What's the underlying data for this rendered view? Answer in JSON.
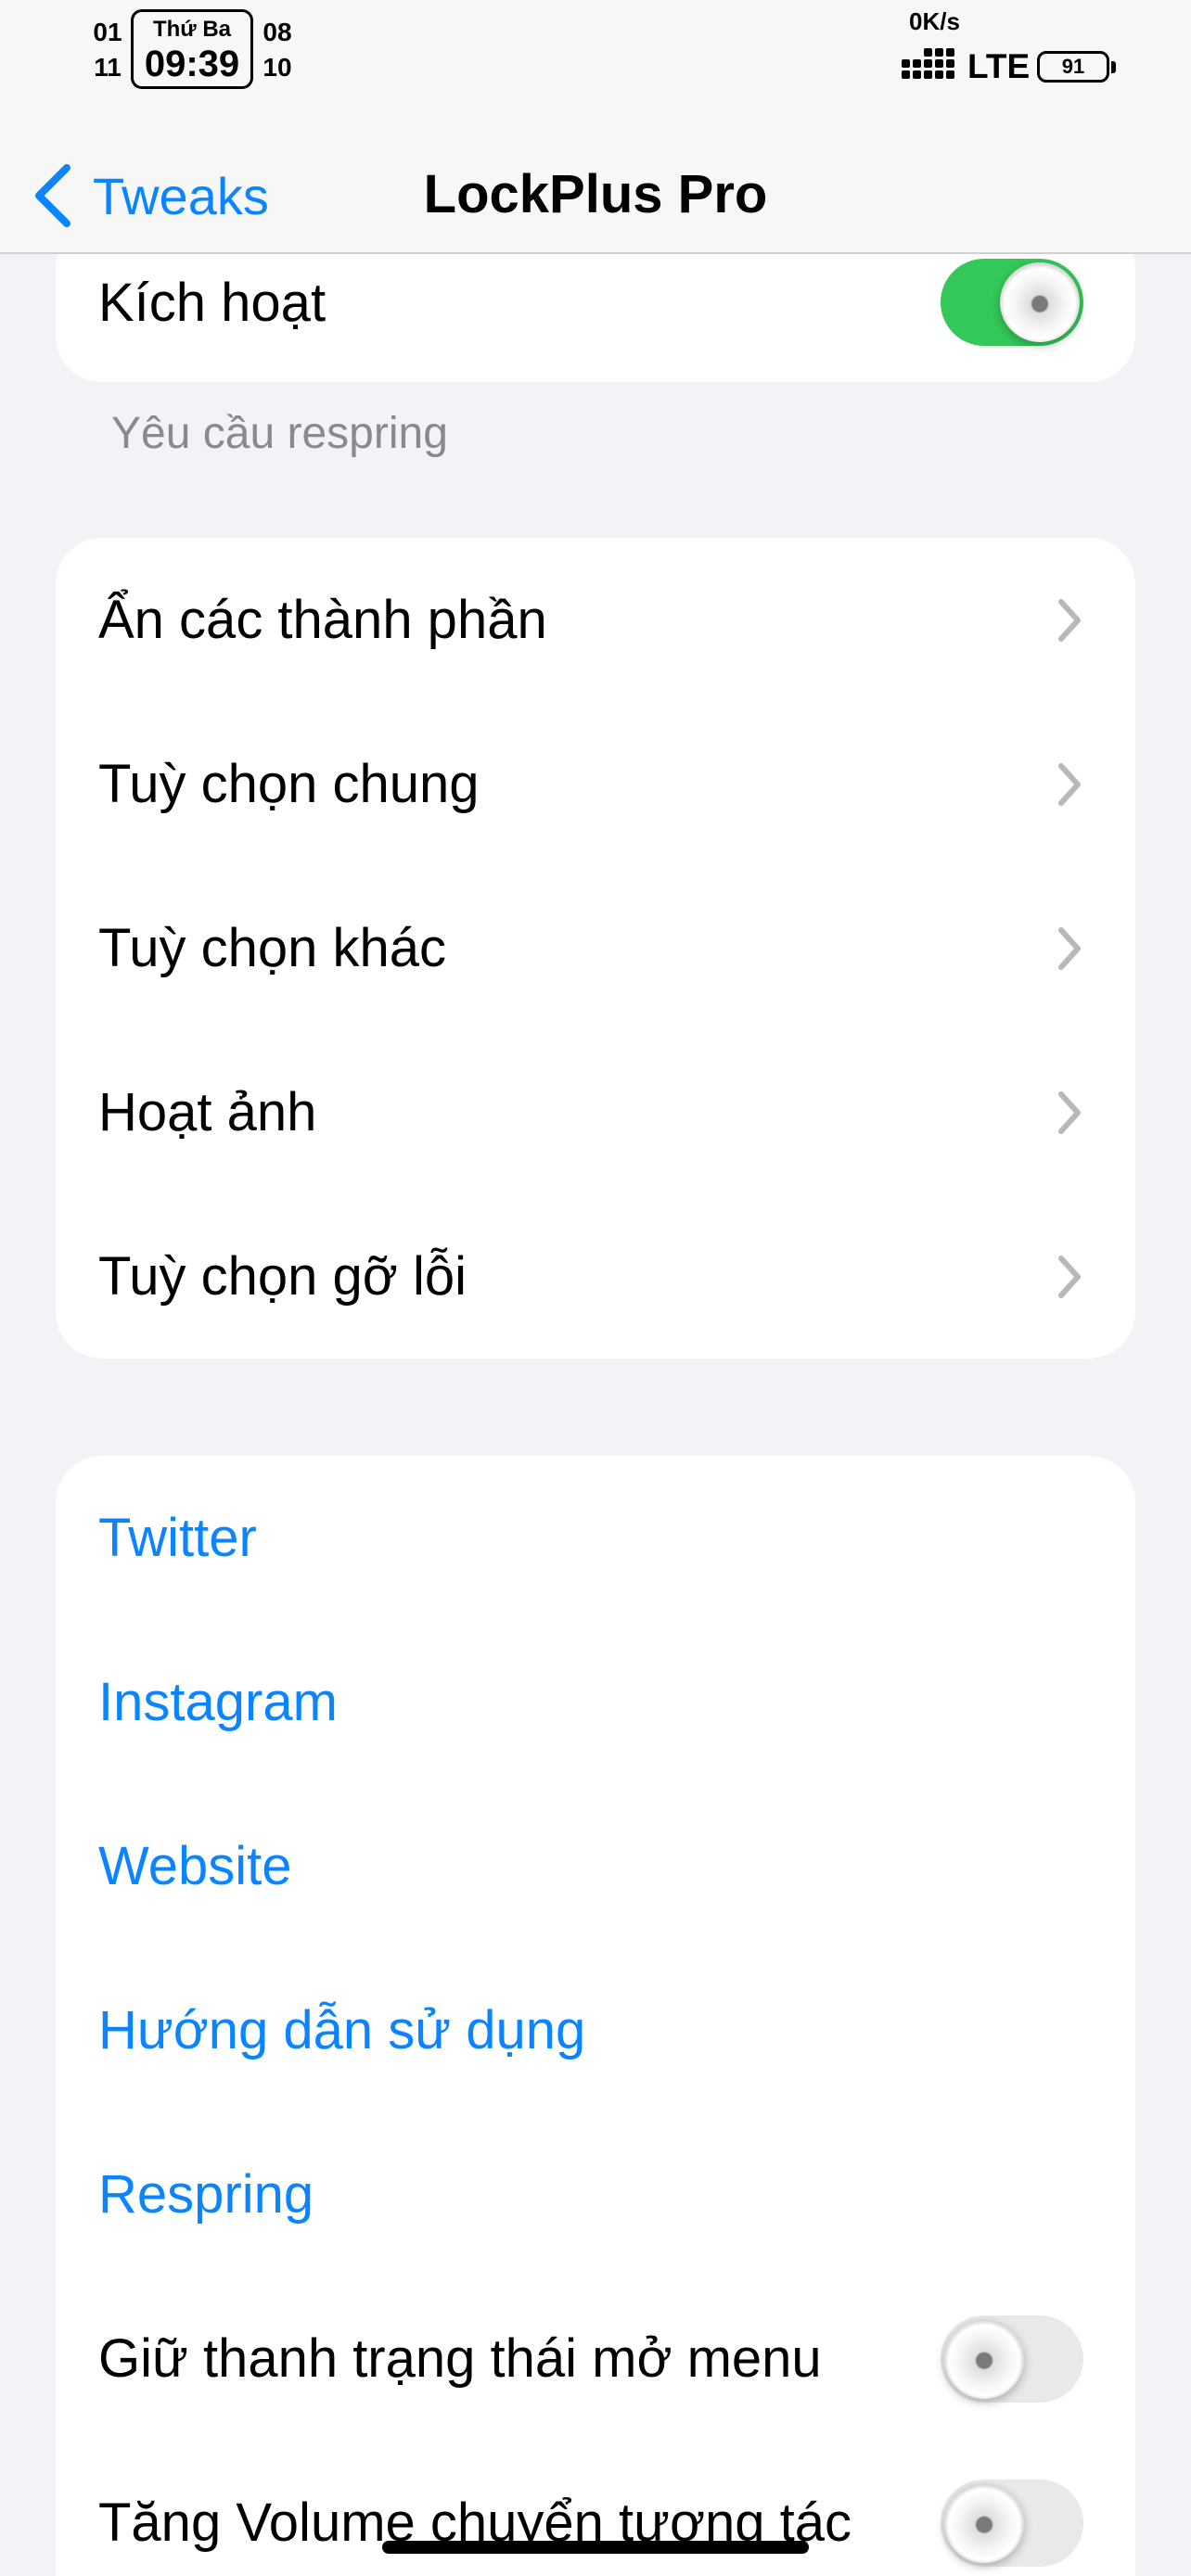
{
  "status_bar": {
    "date_left_top": "01",
    "date_left_bottom": "11",
    "weekday": "Thứ Ba",
    "time": "09:39",
    "date_right_top": "08",
    "date_right_bottom": "10",
    "net_speed": "0K/s",
    "network_type": "LTE",
    "battery": "91"
  },
  "nav": {
    "back_label": "Tweaks",
    "title": "LockPlus Pro"
  },
  "enable_group": {
    "label": "Kích hoạt",
    "enabled": true,
    "footer": "Yêu cầu respring"
  },
  "menu_group": {
    "items": [
      {
        "label": "Ẩn các thành phần"
      },
      {
        "label": "Tuỳ chọn chung"
      },
      {
        "label": "Tuỳ chọn khác"
      },
      {
        "label": "Hoạt ảnh"
      },
      {
        "label": "Tuỳ chọn gỡ lỗi"
      }
    ]
  },
  "links_group": {
    "links": [
      {
        "label": "Twitter"
      },
      {
        "label": "Instagram"
      },
      {
        "label": "Website"
      },
      {
        "label": "Hướng dẫn sử dụng"
      },
      {
        "label": "Respring"
      }
    ],
    "toggles": [
      {
        "label": "Giữ thanh trạng thái mở menu",
        "enabled": false
      },
      {
        "label": "Tăng Volume chuyển tương tác",
        "enabled": false
      }
    ]
  },
  "colors": {
    "accent": "#0a84ff",
    "toggle_on": "#34c759",
    "toggle_off": "#e9e9eb",
    "background": "#f2f2f7"
  }
}
